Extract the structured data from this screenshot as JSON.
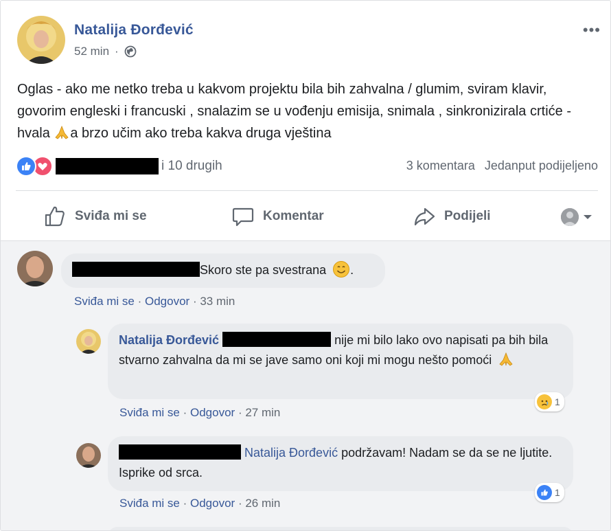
{
  "post": {
    "author": "Natalija Đorđević",
    "time": "52 min",
    "text_before_emoji": "Oglas - ako me netko treba u kakvom projektu bila bih zahvalna / glumim, sviram klavir, govorim engleski i francuski , snalazim se u vođenju emisija, snimala , sinkronizirala crtiće - hvala ",
    "text_after_emoji": "a brzo učim ako treba kakva druga vještina",
    "reactions_tail": "i 10 drugih",
    "comments_count": "3 komentara",
    "shares_count": "Jedanput podijeljeno"
  },
  "actions": {
    "like": "Sviđa mi se",
    "comment": "Komentar",
    "share": "Podijeli"
  },
  "comments": [
    {
      "text": "Skoro ste pa svestrana",
      "text_end": ".",
      "like": "Sviđa mi se",
      "reply": "Odgovor",
      "time": "33 min"
    },
    {
      "author": "Natalija Đorđević",
      "text": "nije mi bilo lako ovo napisati pa bih bila stvarno zahvalna da mi se jave samo oni koji mi mogu nešto pomoći",
      "like": "Sviđa mi se",
      "reply": "Odgovor",
      "time": "27 min",
      "reaction_count": "1"
    },
    {
      "mention": "Natalija Đorđević",
      "text": "podržavam! Nadam se da se ne ljutite. Isprike od srca.",
      "like": "Sviđa mi se",
      "reply": "Odgovor",
      "time": "26 min",
      "reaction_count": "1"
    }
  ],
  "colors": {
    "link": "#385898",
    "muted": "#606770",
    "bubble": "#e9ebee",
    "like_blue": "#3b82f6",
    "love_red": "#f0506e"
  }
}
